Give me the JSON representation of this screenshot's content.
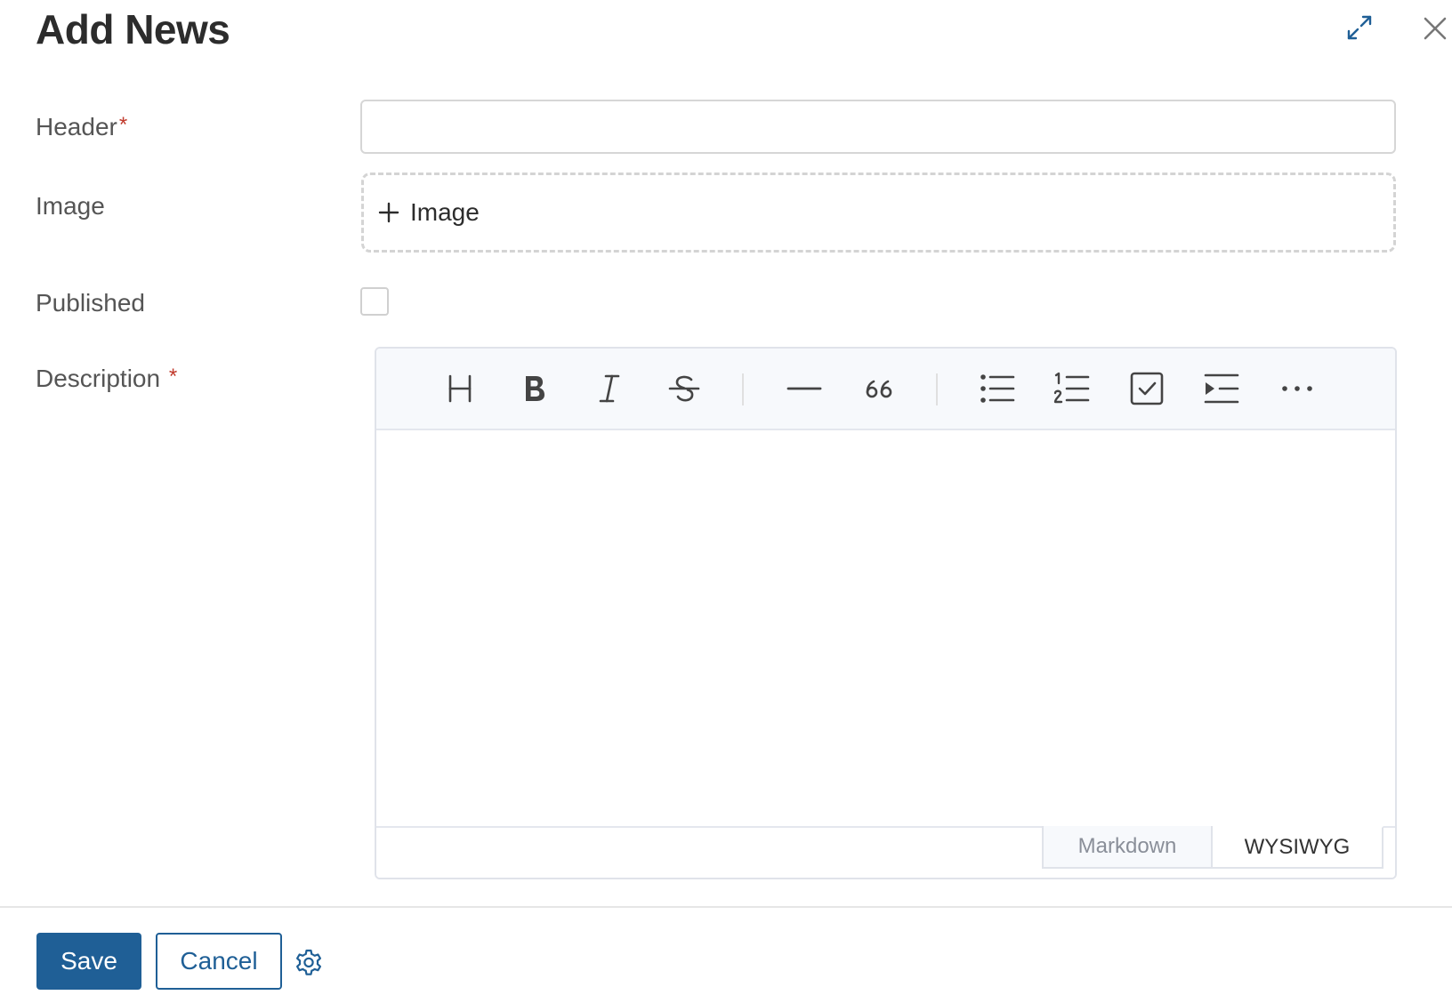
{
  "dialog": {
    "title": "Add News"
  },
  "form": {
    "header": {
      "label": "Header",
      "required_mark": "*",
      "value": ""
    },
    "image": {
      "label": "Image",
      "button_label": "Image"
    },
    "published": {
      "label": "Published",
      "checked": false
    },
    "description": {
      "label": "Description",
      "required_mark": "*"
    }
  },
  "editor": {
    "toolbar": [
      {
        "name": "heading",
        "icon": "heading-icon"
      },
      {
        "name": "bold",
        "icon": "bold-icon"
      },
      {
        "name": "italic",
        "icon": "italic-icon"
      },
      {
        "name": "strike",
        "icon": "strikethrough-icon"
      },
      {
        "name": "hr",
        "icon": "horizontal-rule-icon"
      },
      {
        "name": "quote",
        "icon": "quote-icon"
      },
      {
        "name": "bullet-list",
        "icon": "bullet-list-icon"
      },
      {
        "name": "ordered-list",
        "icon": "ordered-list-icon"
      },
      {
        "name": "task",
        "icon": "checkbox-task-icon"
      },
      {
        "name": "indent",
        "icon": "indent-icon"
      },
      {
        "name": "more",
        "icon": "more-icon"
      }
    ],
    "modes": {
      "markdown": "Markdown",
      "wysiwyg": "WYSIWYG"
    },
    "active_mode": "wysiwyg"
  },
  "footer": {
    "save_label": "Save",
    "cancel_label": "Cancel"
  },
  "colors": {
    "primary": "#1f5f96",
    "required": "#c0392b",
    "toolbar_bg": "#f7f9fc"
  }
}
